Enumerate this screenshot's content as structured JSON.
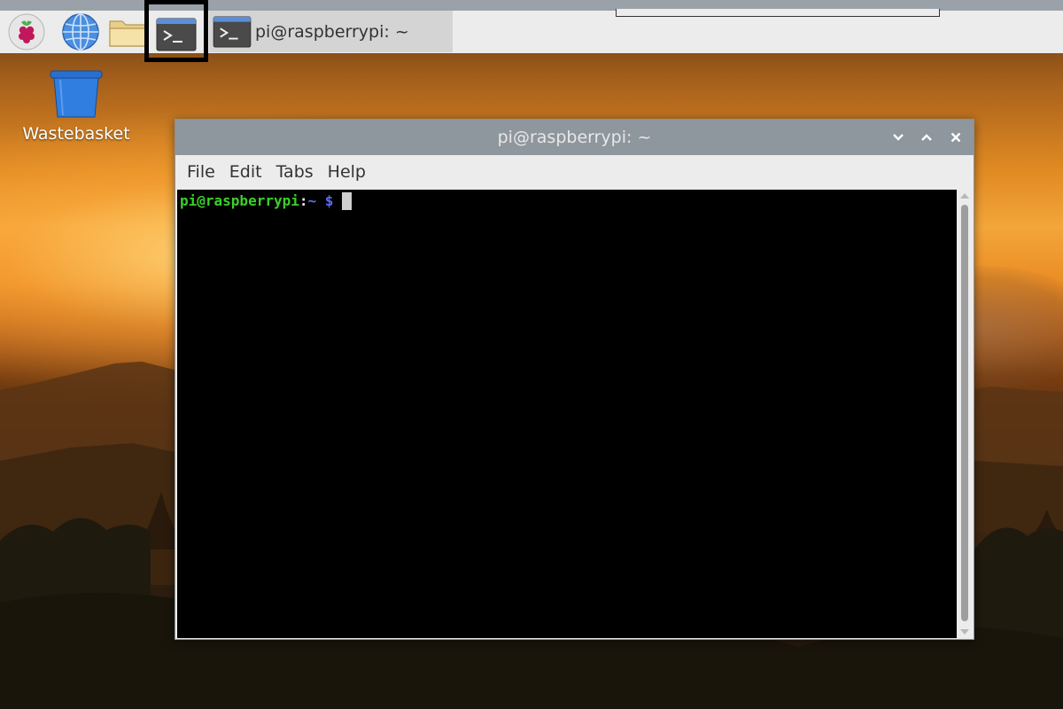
{
  "panel": {
    "task_title": "pi@raspberrypi: ~",
    "launchers": [
      {
        "icon": "raspberry-menu-icon"
      },
      {
        "icon": "web-browser-icon"
      },
      {
        "icon": "file-manager-icon"
      },
      {
        "icon": "terminal-icon"
      }
    ],
    "highlighted_launcher": "terminal"
  },
  "desktop": {
    "icons": [
      {
        "label": "Wastebasket",
        "icon": "wastebasket-icon"
      }
    ]
  },
  "window": {
    "title": "pi@raspberrypi: ~",
    "controls": [
      "minimize-icon",
      "maximize-icon",
      "close-icon"
    ],
    "menu": [
      "File",
      "Edit",
      "Tabs",
      "Help"
    ]
  },
  "terminal": {
    "prompt_user": "pi@raspberrypi",
    "prompt_separator": ":",
    "prompt_path": "~",
    "prompt_symbol": "$",
    "colors": {
      "background": "#000000",
      "user": "#3ccf2a",
      "path": "#5d6df0"
    }
  }
}
